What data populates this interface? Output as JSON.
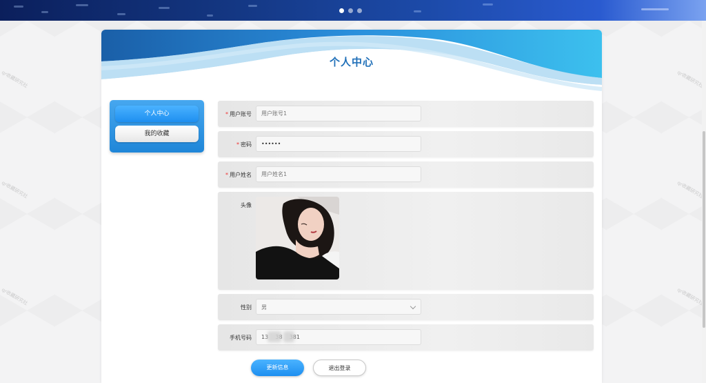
{
  "banner": {
    "slide_count": 3,
    "active_slide": 1
  },
  "card": {
    "title": "个人中心"
  },
  "sidebar": {
    "items": [
      {
        "label": "个人中心",
        "active": true
      },
      {
        "label": "我的收藏",
        "active": false
      }
    ]
  },
  "form": {
    "account": {
      "label": "用户账号",
      "required": "*",
      "placeholder": "用户账号1"
    },
    "password": {
      "label": "密码",
      "required": "*",
      "value": "••••••"
    },
    "name": {
      "label": "用户姓名",
      "required": "*",
      "placeholder": "用户姓名1"
    },
    "avatar": {
      "label": "头像"
    },
    "gender": {
      "label": "性别",
      "value": "男"
    },
    "phone": {
      "label": "手机号码",
      "value": "13    38    381"
    }
  },
  "buttons": {
    "update": "更新信息",
    "logout": "退出登录"
  },
  "watermark": "qr收藏研究社"
}
